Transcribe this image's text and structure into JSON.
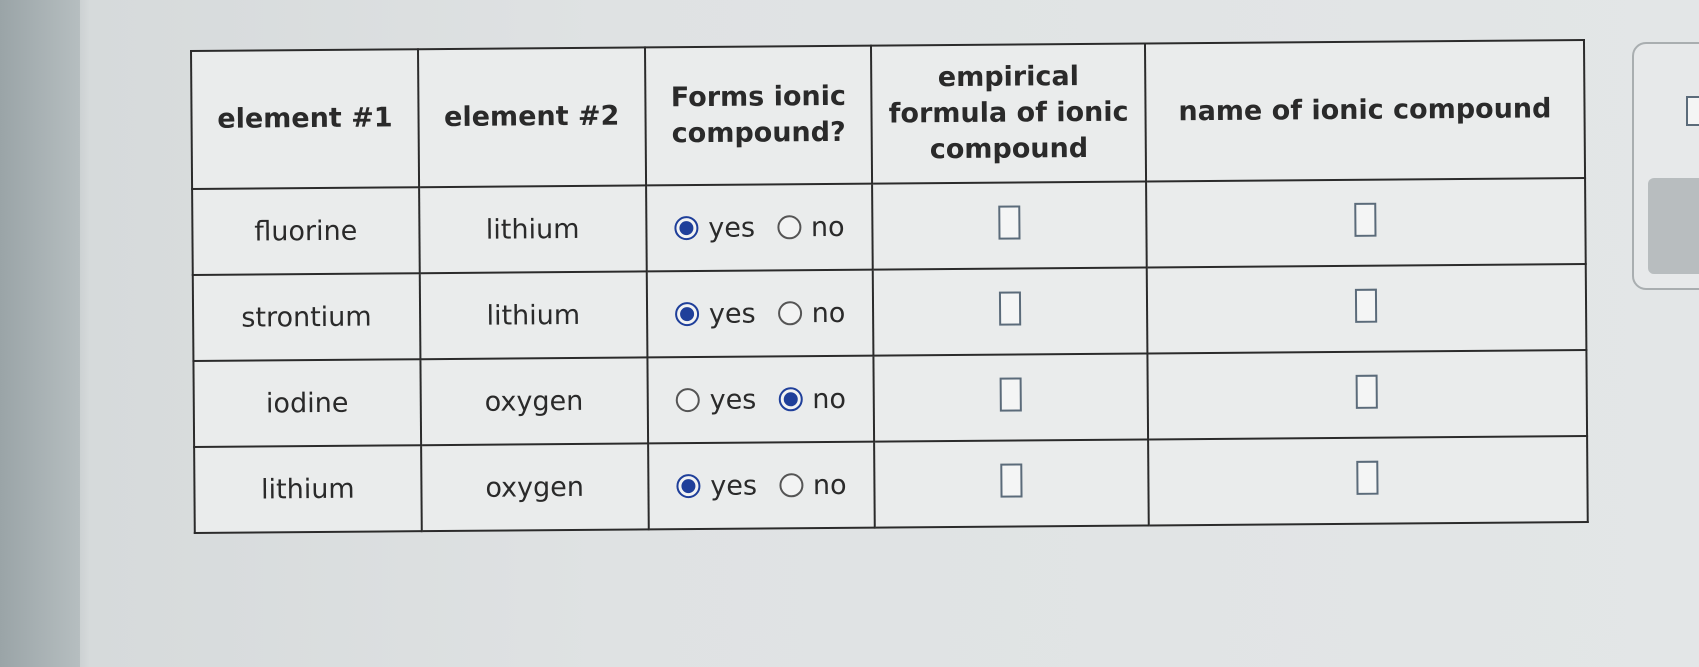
{
  "table": {
    "headers": [
      "element #1",
      "element #2",
      "Forms ionic compound?",
      "empirical formula of ionic compound",
      "name of ionic compound"
    ],
    "radio_labels": {
      "yes": "yes",
      "no": "no"
    },
    "rows": [
      {
        "element1": "fluorine",
        "element2": "lithium",
        "forms_ionic": "yes",
        "formula": "",
        "name": ""
      },
      {
        "element1": "strontium",
        "element2": "lithium",
        "forms_ionic": "yes",
        "formula": "",
        "name": ""
      },
      {
        "element1": "iodine",
        "element2": "oxygen",
        "forms_ionic": "no",
        "formula": "",
        "name": ""
      },
      {
        "element1": "lithium",
        "element2": "oxygen",
        "forms_ionic": "yes",
        "formula": "",
        "name": ""
      }
    ]
  },
  "colors": {
    "selected_radio": "#1f3f9a",
    "border": "#2b2b2b"
  }
}
